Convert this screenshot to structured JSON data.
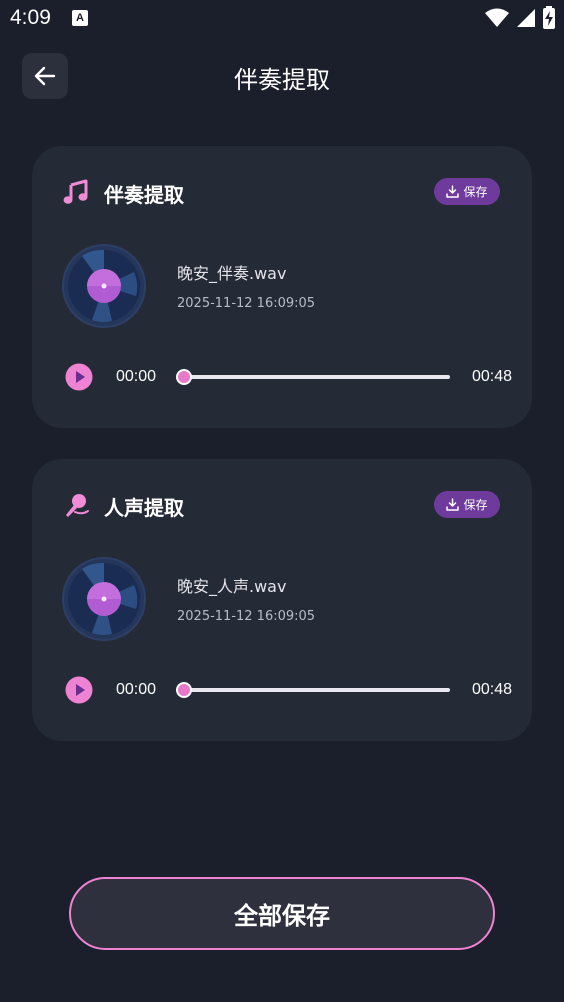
{
  "status_bar": {
    "time": "4:09",
    "notification_badge": "A",
    "icons": [
      "wifi-icon",
      "cell-signal-icon",
      "battery-charging-icon"
    ]
  },
  "header": {
    "title": "伴奏提取",
    "back_icon": "arrow-left-icon"
  },
  "tracks": [
    {
      "title": "伴奏提取",
      "icon": "music-note-icon",
      "save_label": "保存",
      "file_name": "晚安_伴奏.wav",
      "date": "2025-11-12 16:09:05",
      "current_time": "00:00",
      "duration": "00:48",
      "progress": 0
    },
    {
      "title": "人声提取",
      "icon": "microphone-icon",
      "save_label": "保存",
      "file_name": "晚安_人声.wav",
      "date": "2025-11-12 16:09:05",
      "current_time": "00:00",
      "duration": "00:48",
      "progress": 0
    }
  ],
  "save_all_label": "全部保存",
  "colors": {
    "background": "#1b1f2b",
    "card": "#252a37",
    "accent_pink": "#e879c9",
    "save_chip": "#6e3a9c"
  }
}
